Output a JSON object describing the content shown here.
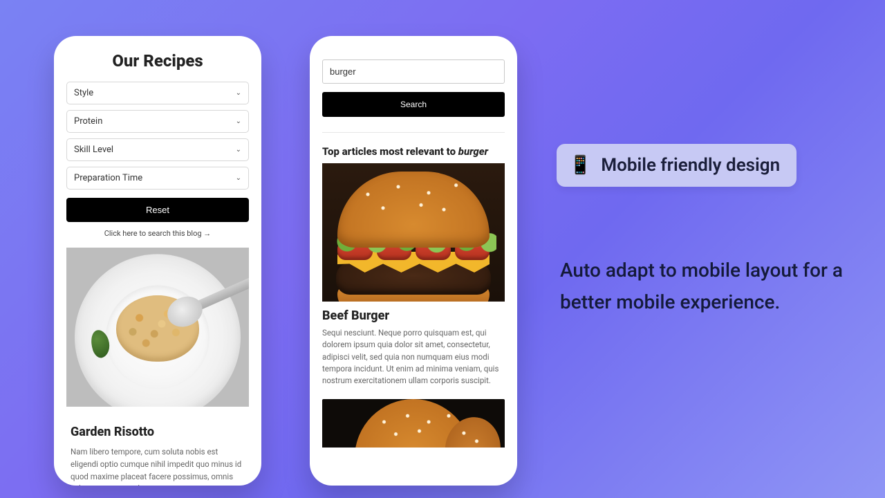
{
  "phone1": {
    "title": "Our Recipes",
    "filters": {
      "style": "Style",
      "protein": "Protein",
      "skill": "Skill Level",
      "prep": "Preparation Time"
    },
    "reset_label": "Reset",
    "search_link": "Click here to search this blog →",
    "card": {
      "title": "Garden Risotto",
      "text": "Nam libero tempore, cum soluta nobis est eligendi optio cumque nihil impedit quo minus id quod maxime placeat facere possimus, omnis voluptas assumenda"
    }
  },
  "phone2": {
    "search_value": "burger",
    "search_button": "Search",
    "heading_prefix": "Top articles most relevant to ",
    "heading_keyword": "burger",
    "card": {
      "title": "Beef Burger",
      "text": "Sequi nesciunt. Neque porro quisquam est, qui dolorem ipsum quia dolor sit amet, consectetur, adipisci velit, sed quia non numquam eius modi tempora incidunt. Ut enim ad minima veniam, quis nostrum exercitationem ullam corporis suscipit."
    }
  },
  "marketing": {
    "badge_icon": "📱",
    "badge_text": "Mobile friendly design",
    "copy": "Auto adapt to mobile layout for a better mobile experience."
  }
}
